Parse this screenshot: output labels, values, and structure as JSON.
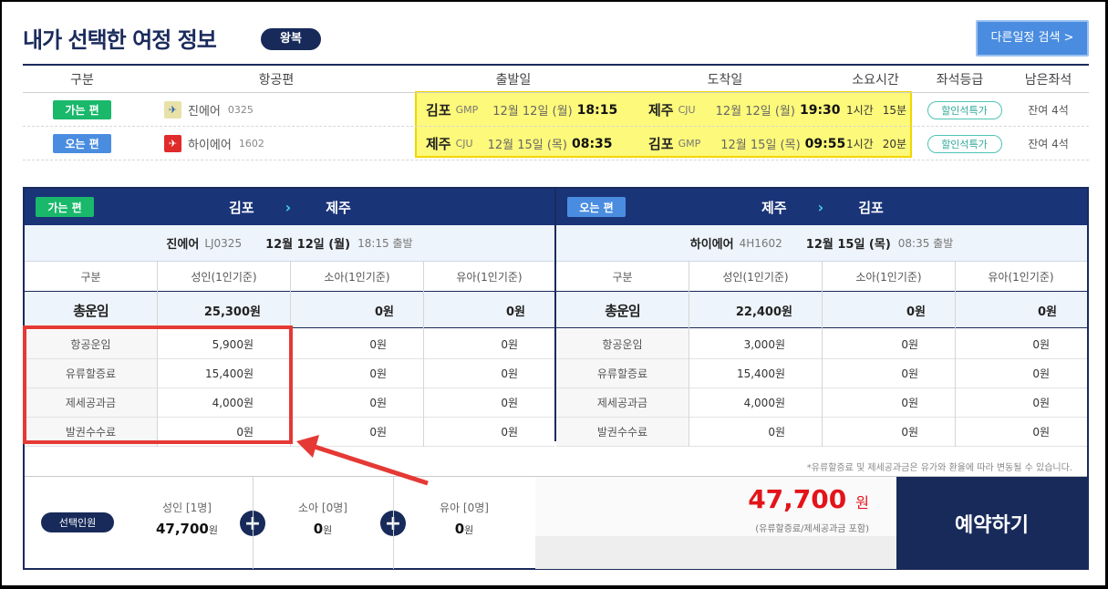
{
  "header": {
    "title": "내가 선택한 여정 정보",
    "trip_type": "왕복",
    "other_search": "다른일정 검색 >"
  },
  "summary": {
    "columns": [
      "구분",
      "항공편",
      "출발일",
      "도착일",
      "소요시간",
      "좌석등급",
      "남은좌석"
    ],
    "rows": [
      {
        "badge": "가는 편",
        "airline": "진에어",
        "flight": "0325",
        "dep_city": "김포",
        "dep_code": "GMP",
        "dep_date": "12월 12일 (월)",
        "dep_time": "18:15",
        "arr_city": "제주",
        "arr_code": "CJU",
        "arr_date": "12월 12일 (월)",
        "arr_time": "19:30",
        "duration_h": "1시간",
        "duration_m": "15분",
        "seat_class": "할인석특가",
        "remaining": "잔여 4석"
      },
      {
        "badge": "오는 편",
        "airline": "하이에어",
        "flight": "1602",
        "dep_city": "제주",
        "dep_code": "CJU",
        "dep_date": "12월 15일 (목)",
        "dep_time": "08:35",
        "arr_city": "김포",
        "arr_code": "GMP",
        "arr_date": "12월 15일 (목)",
        "arr_time": "09:55",
        "duration_h": "1시간",
        "duration_m": "20분",
        "seat_class": "할인석특가",
        "remaining": "잔여 4석"
      }
    ]
  },
  "fare": {
    "outbound": {
      "badge": "가는 편",
      "from": "김포",
      "to": "제주",
      "airline": "진에어",
      "flight": "LJ0325",
      "date": "12월 12일 (월)",
      "depart": "18:15 출발",
      "columns": [
        "구분",
        "성인(1인기준)",
        "소아(1인기준)",
        "유아(1인기준)"
      ],
      "total_label": "총운임",
      "total": [
        "25,300원",
        "0원",
        "0원"
      ],
      "items": [
        {
          "label": "항공운임",
          "values": [
            "5,900원",
            "0원",
            "0원"
          ]
        },
        {
          "label": "유류할증료",
          "values": [
            "15,400원",
            "0원",
            "0원"
          ]
        },
        {
          "label": "제세공과금",
          "values": [
            "4,000원",
            "0원",
            "0원"
          ]
        },
        {
          "label": "발권수수료",
          "values": [
            "0원",
            "0원",
            "0원"
          ]
        }
      ]
    },
    "inbound": {
      "badge": "오는 편",
      "from": "제주",
      "to": "김포",
      "airline": "하이에어",
      "flight": "4H1602",
      "date": "12월 15일 (목)",
      "depart": "08:35 출발",
      "columns": [
        "구분",
        "성인(1인기준)",
        "소아(1인기준)",
        "유아(1인기준)"
      ],
      "total_label": "총운임",
      "total": [
        "22,400원",
        "0원",
        "0원"
      ],
      "items": [
        {
          "label": "항공운임",
          "values": [
            "3,000원",
            "0원",
            "0원"
          ]
        },
        {
          "label": "유류할증료",
          "values": [
            "15,400원",
            "0원",
            "0원"
          ]
        },
        {
          "label": "제세공과금",
          "values": [
            "4,000원",
            "0원",
            "0원"
          ]
        },
        {
          "label": "발권수수료",
          "values": [
            "0원",
            "0원",
            "0원"
          ]
        }
      ]
    },
    "note": "*유류할증료 및 제세공과금은 유가와 환율에 따라 변동될 수 있습니다."
  },
  "booking": {
    "selected_label": "선택인원",
    "adult_label": "성인 [1명]",
    "adult_value": "47,700",
    "won": "원",
    "child_label": "소아 [0명]",
    "child_value": "0",
    "infant_label": "유아 [0명]",
    "infant_value": "0",
    "total": "47,700",
    "total_unit": "원",
    "total_note": "(유류할증료/제세공과금 포함)",
    "book_button": "예약하기"
  },
  "colors": {
    "navy": "#172a5a",
    "go_green": "#19b86b",
    "return_blue": "#4a8de0",
    "highlight_yellow": "#fdf97a",
    "price_red": "#e2141a",
    "annotation_red": "#e53935"
  }
}
